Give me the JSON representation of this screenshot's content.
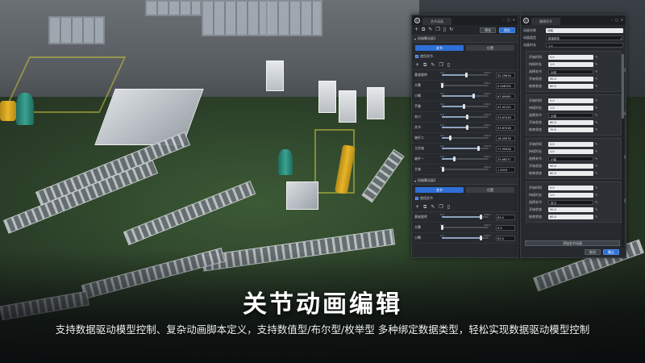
{
  "caption": {
    "title": "关节动画编辑",
    "subtitle": "支持数据驱动模型控制、复杂动画脚本定义，支持数值型/布尔型/枚举型 多种绑定数据类型，轻松实现数据驱动模型控制"
  },
  "left_panel": {
    "tab": "关节动画",
    "preview_label": "预览",
    "save_label": "保存",
    "section1": {
      "title": "机械臂动画1",
      "seg_on": "关节",
      "seg_off": "位置",
      "check_label": "使用关节",
      "sliders": [
        {
          "label": "基座旋转",
          "min": "0.0",
          "max": "100.0",
          "value": "52.29616",
          "fraction": 0.52
        },
        {
          "label": "大臂",
          "min": "0.0",
          "max": "100.0",
          "value": "0.008705",
          "fraction": 0.0
        },
        {
          "label": "小臂",
          "min": "0.0",
          "max": "100.0",
          "value": "67.89365",
          "fraction": 0.68
        },
        {
          "label": "手腕",
          "min": "0.0",
          "max": "100.0",
          "value": "47.42122",
          "fraction": 0.47
        },
        {
          "label": "夹爪",
          "min": "0.0",
          "max": "100.0",
          "value": "53.67416",
          "fraction": 0.54
        },
        {
          "label": "关节",
          "min": "0.0",
          "max": "100.0",
          "value": "53.67416",
          "fraction": 0.54
        },
        {
          "label": "轴杆二",
          "min": "0.0",
          "max": "100.0",
          "value": "18.09576",
          "fraction": 0.18
        },
        {
          "label": "立柱轴",
          "min": "0.0",
          "max": "100.0",
          "value": "77.99328",
          "fraction": 0.78
        },
        {
          "label": "轴杆一",
          "min": "0.0",
          "max": "100.0",
          "value": "25.66271",
          "fraction": 0.26
        },
        {
          "label": "主轴",
          "min": "0.0",
          "max": "100.0",
          "value": "1.5519",
          "fraction": 0.02
        }
      ]
    },
    "section2": {
      "title": "机械臂动画2",
      "seg_on": "关节",
      "seg_off": "位置",
      "check_label": "使用关节",
      "sliders": [
        {
          "label": "基座旋转",
          "min": "0.0",
          "max": "100.0",
          "value": "83.0",
          "fraction": 0.83
        },
        {
          "label": "大臂",
          "min": "0.0",
          "max": "100.0",
          "value": "0.0",
          "fraction": 0.0
        },
        {
          "label": "小臂",
          "min": "0.0",
          "max": "100.0",
          "value": "83.0",
          "fraction": 0.83
        }
      ]
    }
  },
  "right_panel": {
    "tab": "编辑关节",
    "header_fields": [
      {
        "label": "动画名称",
        "value": "动画",
        "dark": false,
        "dropdown": false
      },
      {
        "label": "动画类型",
        "value": "数值类型",
        "dark": true,
        "dropdown": true
      },
      {
        "label": "动画时长",
        "value": "1.0",
        "dark": true,
        "dropdown": false
      }
    ],
    "groups": [
      {
        "rows": [
          {
            "label": "开始时间",
            "value": "0.0",
            "dark": false
          },
          {
            "label": "持续时长",
            "value": "1.0",
            "dark": false
          },
          {
            "label": "选择关节",
            "value": "大臂",
            "dark": true
          },
          {
            "label": "开始状态",
            "value": "90.0",
            "dark": false
          },
          {
            "label": "结束状态",
            "value": "80.0",
            "dark": false
          }
        ]
      },
      {
        "rows": [
          {
            "label": "开始时间",
            "value": "0.0",
            "dark": false
          },
          {
            "label": "持续时长",
            "value": "1.0",
            "dark": false
          },
          {
            "label": "选择关节",
            "value": "大臂",
            "dark": true
          },
          {
            "label": "开始状态",
            "value": "80.0",
            "dark": false
          },
          {
            "label": "结束状态",
            "value": "70.0",
            "dark": false
          }
        ]
      },
      {
        "rows": [
          {
            "label": "开始时间",
            "value": "0.0",
            "dark": false
          },
          {
            "label": "持续时长",
            "value": "1.0",
            "dark": false
          },
          {
            "label": "选择关节",
            "value": "小臂",
            "dark": true
          },
          {
            "label": "开始状态",
            "value": "90.0",
            "dark": false
          },
          {
            "label": "结束状态",
            "value": "80.0",
            "dark": false
          }
        ]
      },
      {
        "rows": [
          {
            "label": "开始时间",
            "value": "0.0",
            "dark": false
          },
          {
            "label": "持续时长",
            "value": "1.0",
            "dark": false
          },
          {
            "label": "选择关节",
            "value": "夹爪",
            "dark": true
          },
          {
            "label": "开始状态",
            "value": "90.0",
            "dark": false
          },
          {
            "label": "结束状态",
            "value": "80.0",
            "dark": false
          }
        ]
      }
    ],
    "add_label": "添加关节动画",
    "cancel_label": "取消",
    "confirm_label": "确认"
  },
  "colors": {
    "accent": "#2f6fd6",
    "panel": "#26292d",
    "caption": "#ffffff"
  }
}
